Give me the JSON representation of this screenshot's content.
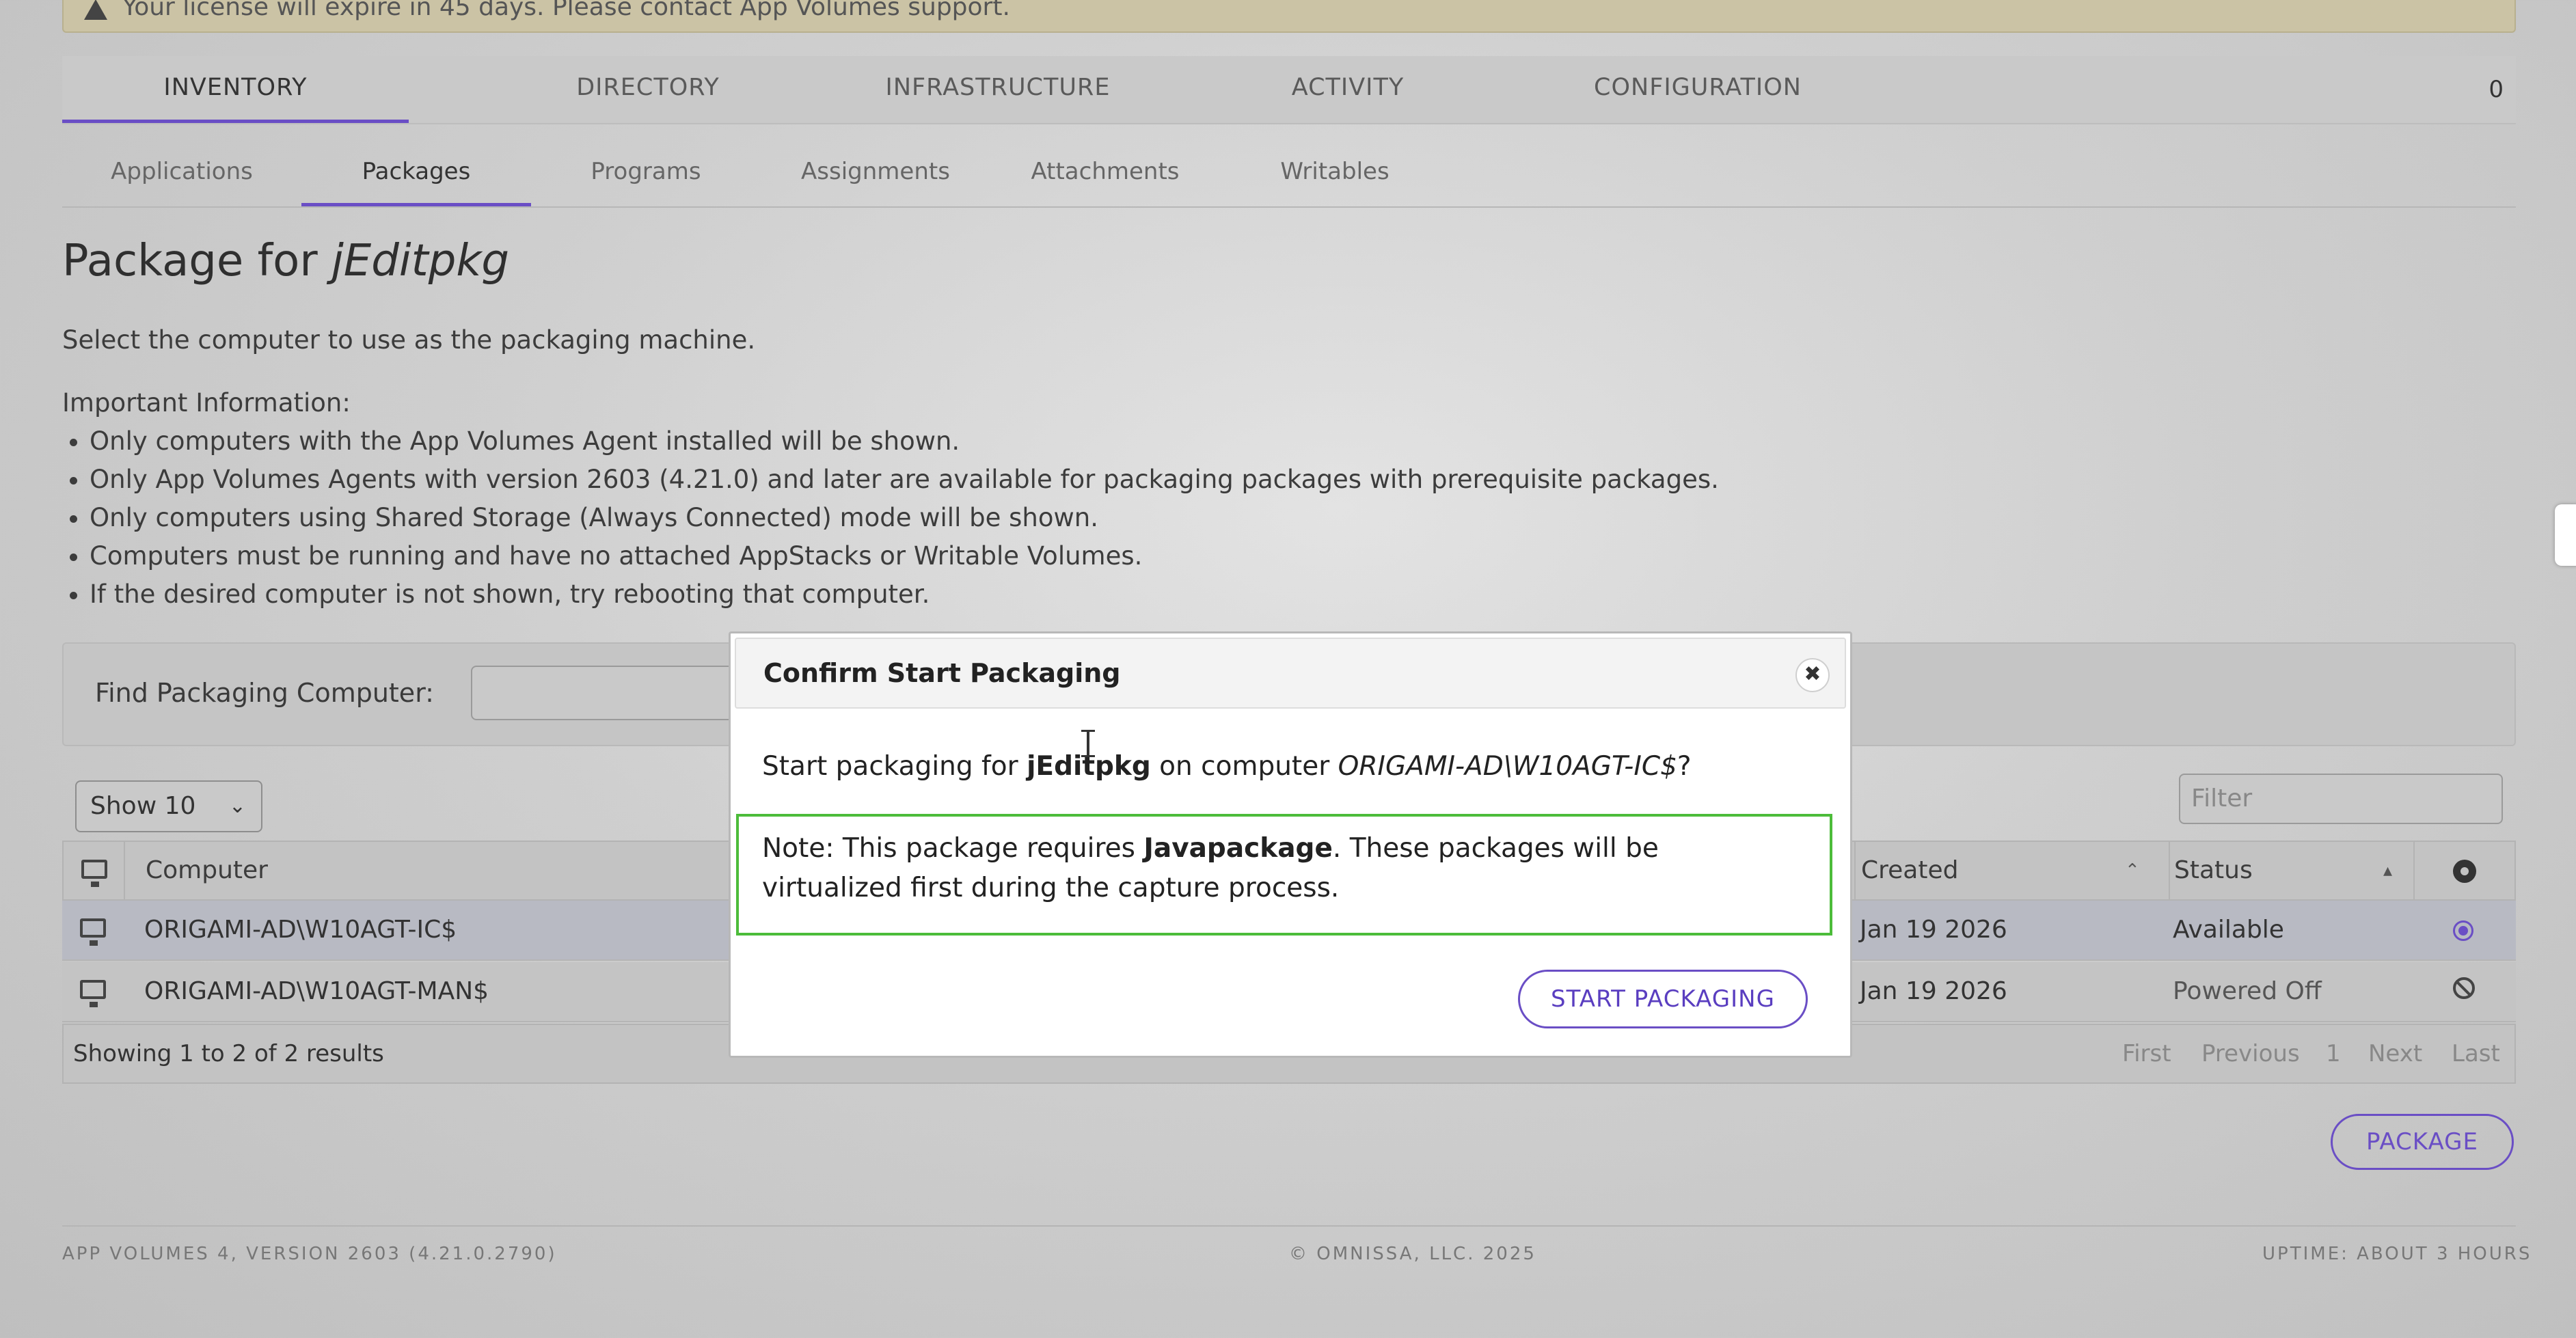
{
  "license_banner": {
    "text": "Your license will expire in 45 days. Please contact App Volumes support."
  },
  "main_tabs": [
    "INVENTORY",
    "DIRECTORY",
    "INFRASTRUCTURE",
    "ACTIVITY",
    "CONFIGURATION"
  ],
  "header_counter": "0",
  "sub_tabs": [
    "Applications",
    "Packages",
    "Programs",
    "Assignments",
    "Attachments",
    "Writables"
  ],
  "page": {
    "title_prefix": "Package for ",
    "title_name": "jEditpkg",
    "instruction": "Select the computer to use as the packaging machine.",
    "important_title": "Important Information:",
    "bullets": [
      "Only computers with the App Volumes Agent installed will be shown.",
      "Only App Volumes Agents with version 2603 (4.21.0) and later are available for packaging packages with prerequisite packages.",
      "Only computers using Shared Storage (Always Connected) mode will be shown.",
      "Computers must be running and have no attached AppStacks or Writable Volumes.",
      "If the desired computer is not shown, try rebooting that computer."
    ]
  },
  "find": {
    "label": "Find Packaging Computer:",
    "value": ""
  },
  "table": {
    "show_select": "Show 10",
    "filter_placeholder": "Filter",
    "columns": {
      "computer": "Computer",
      "created": "Created",
      "status": "Status"
    },
    "rows": [
      {
        "computer": "ORIGAMI-AD\\W10AGT-IC$",
        "created": "Jan 19 2026",
        "status": "Available"
      },
      {
        "computer": "ORIGAMI-AD\\W10AGT-MAN$",
        "created": "Jan 19 2026",
        "status": "Powered Off"
      }
    ],
    "showing": "Showing 1 to 2 of 2 results",
    "pager": {
      "first": "First",
      "previous": "Previous",
      "page": "1",
      "next": "Next",
      "last": "Last"
    }
  },
  "package_button": "PACKAGE",
  "footer": {
    "version": "APP VOLUMES 4, VERSION 2603 (4.21.0.2790)",
    "copyright": "© OMNISSA, LLC. 2025",
    "uptime": "UPTIME: ABOUT 3 HOURS"
  },
  "modal": {
    "title": "Confirm Start Packaging",
    "close": "✖",
    "msg_pre": "Start packaging for ",
    "msg_pkg": "jEditpkg",
    "msg_mid": " on computer ",
    "msg_computer": "ORIGAMI-AD\\W10AGT-IC$",
    "msg_end": "?",
    "note_pre": "Note: This package requires ",
    "note_pkg": "Javapackage",
    "note_post": ". These packages will be virtualized first during the capture process.",
    "start_button": "START PACKAGING"
  },
  "colors": {
    "accent": "#6a4ec5",
    "note_border": "#4cbc3a"
  }
}
